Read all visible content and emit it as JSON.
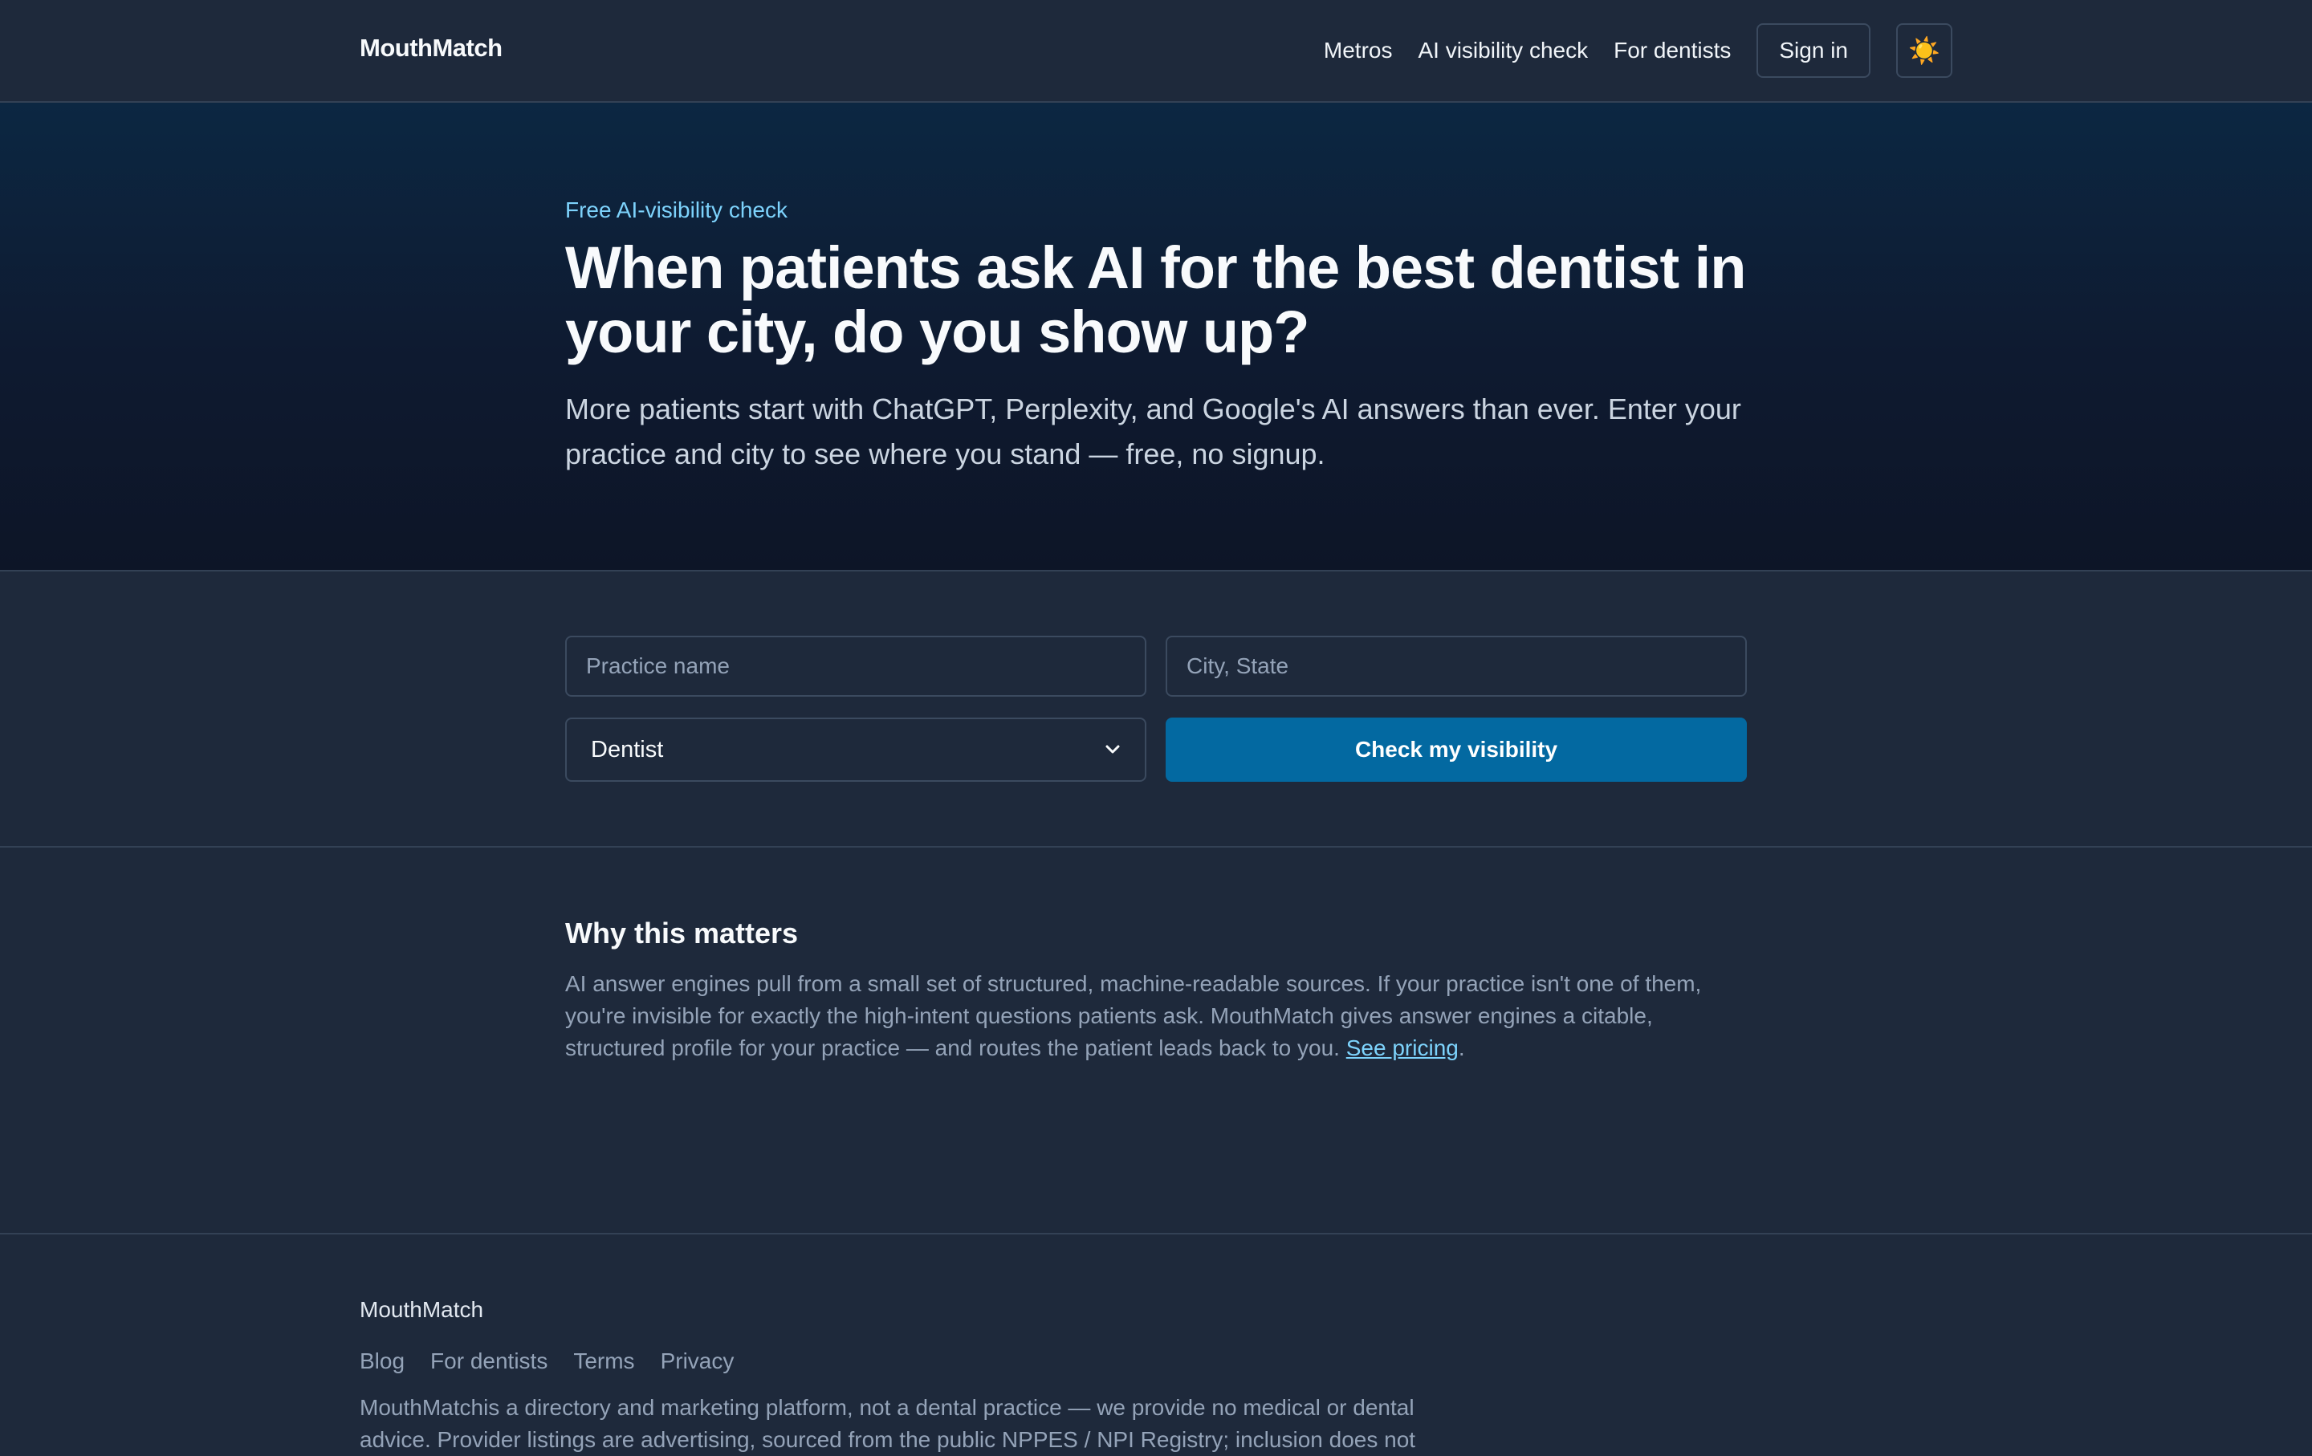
{
  "header": {
    "logo": "MouthMatch",
    "nav": [
      "Metros",
      "AI visibility check",
      "For dentists"
    ],
    "signin": "Sign in",
    "theme_icon": "sun-icon",
    "theme_glyph": "☀️"
  },
  "hero": {
    "eyebrow": "Free AI-visibility check",
    "title": "When patients ask AI for the best dentist in your city, do you show up?",
    "subtitle": "More patients start with ChatGPT, Perplexity, and Google's AI answers than ever. Enter your practice and city to see where you stand — free, no signup."
  },
  "form": {
    "practice_placeholder": "Practice name",
    "city_placeholder": "City, State",
    "specialty_selected": "Dentist",
    "submit": "Check my visibility"
  },
  "why": {
    "heading": "Why this matters",
    "body": "AI answer engines pull from a small set of structured, machine-readable sources. If your practice isn't one of them, you're invisible for exactly the high-intent questions patients ask. MouthMatch gives answer engines a citable, structured profile for your practice — and routes the patient leads back to you.",
    "link": "See pricing",
    "after_link": "."
  },
  "footer": {
    "brand": "MouthMatch",
    "links": [
      "Blog",
      "For dentists",
      "Terms",
      "Privacy"
    ],
    "disclaimer": "MouthMatchis a directory and marketing platform, not a dental practice — we provide no medical or dental advice. Provider listings are advertising, sourced from the public NPPES / NPI Registry; inclusion does not"
  },
  "colors": {
    "accent": "#0369a1",
    "link": "#7dd3fc",
    "background": "#1e293b"
  }
}
